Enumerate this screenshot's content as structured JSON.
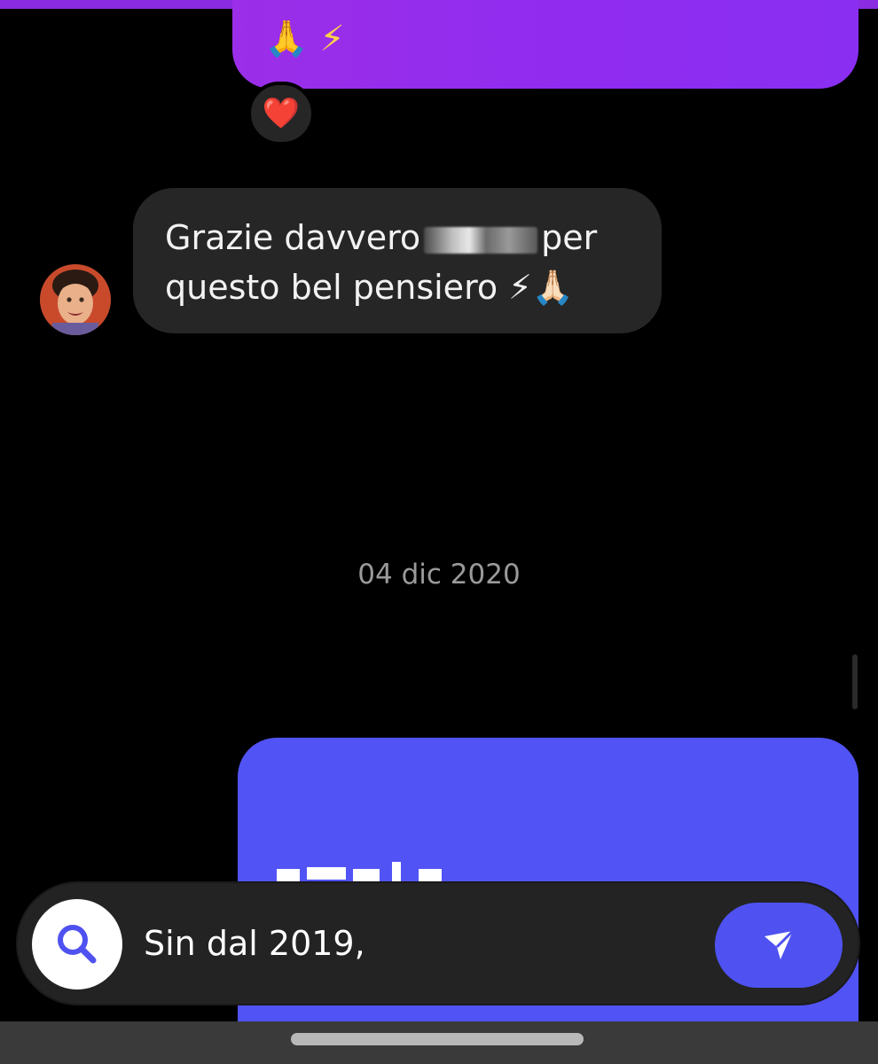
{
  "conversation": {
    "sent_message_top": {
      "text": "🙏 ⚡"
    },
    "reaction": {
      "emoji": "❤️"
    },
    "received_message": {
      "line1_before_redaction": "Grazie davvero",
      "line1_after_redaction": "per",
      "line2": "questo bel pensiero ⚡🙏🏻",
      "avatar_icon": "avatar-photo"
    },
    "date_separator": "04 dic 2020",
    "card_message": {
      "color": "#5153f5"
    }
  },
  "composer": {
    "value": "Sin dal 2019,",
    "search_icon": "search-icon",
    "send_icon": "send-icon",
    "accent": "#4f52f0"
  },
  "colors": {
    "background": "#000000",
    "sent_bubble": "#8f2cf0",
    "received_bubble": "#262626"
  }
}
